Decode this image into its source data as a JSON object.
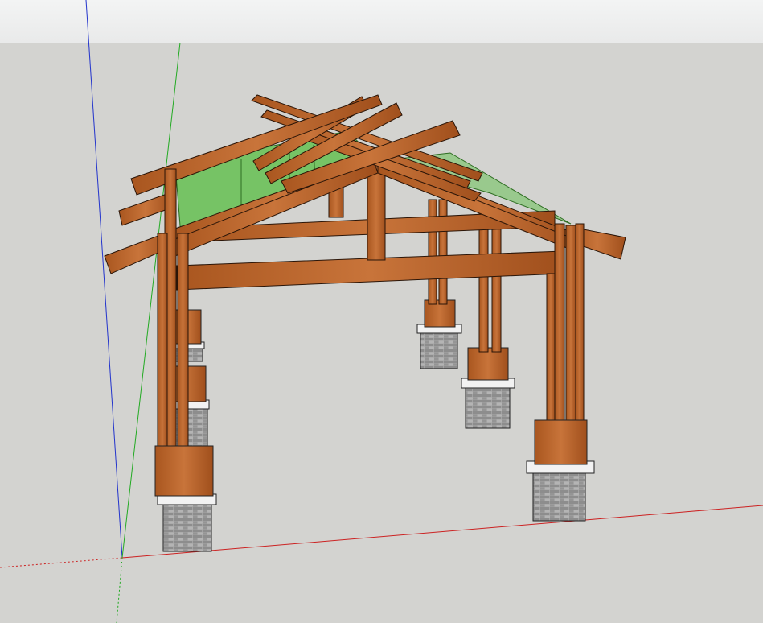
{
  "scene": {
    "sky_color": "#eeefef",
    "ground_color": "#d3d3d0",
    "axis_colors": {
      "blue": "#2233cc",
      "green": "#22aa22",
      "red": "#cc2222"
    },
    "wood_color": "#b9652c",
    "glass_color": "#5fbf4a",
    "pier_color": "#9a9a9a"
  }
}
